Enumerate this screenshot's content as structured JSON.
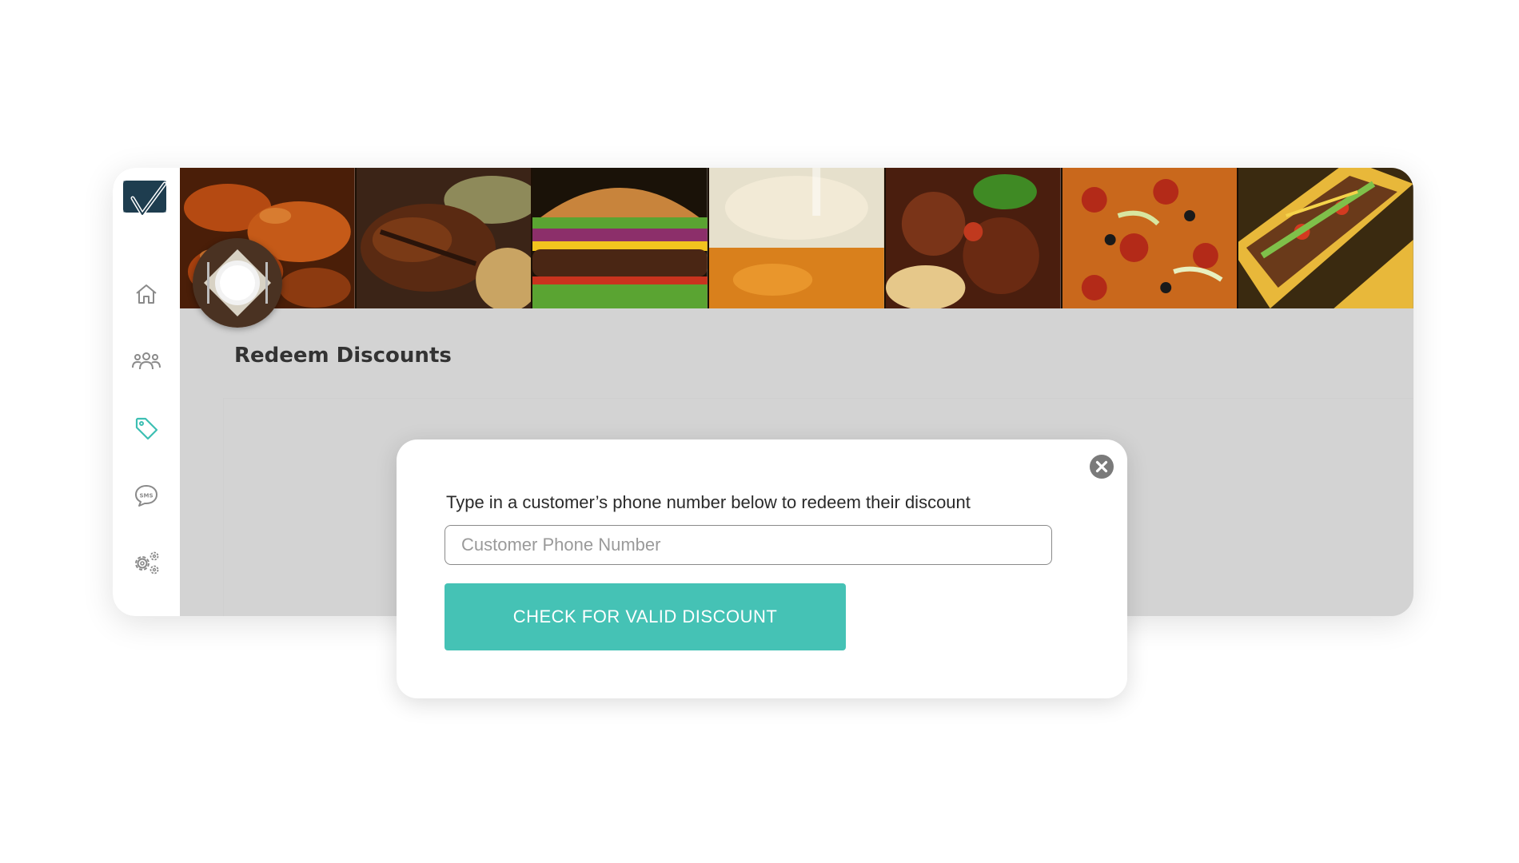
{
  "colors": {
    "accent": "#45c2b5",
    "active_nav": "#3dbfb3",
    "nav_icon": "#8a8a8a",
    "app_background": "#d3d3d3",
    "logo": "#1e3d4f"
  },
  "sidebar": {
    "logo_icon": "check-badge-icon",
    "items": [
      {
        "icon": "home-icon",
        "active": false
      },
      {
        "icon": "users-icon",
        "active": false
      },
      {
        "icon": "tag-icon",
        "active": true
      },
      {
        "icon": "sms-chat-icon",
        "active": false,
        "icon_text": "SMS"
      },
      {
        "icon": "settings-gears-icon",
        "active": false
      }
    ]
  },
  "banner": {
    "tiles": [
      "buffalo-wings",
      "bbq-ribs",
      "burger",
      "beer",
      "spaghetti-meatballs",
      "pizza",
      "tacos"
    ],
    "avatar_icon": "dinner-plate-icon"
  },
  "page": {
    "title": "Redeem Discounts"
  },
  "modal": {
    "instruction": "Type in a customer’s phone number below to redeem their discount",
    "phone_input": {
      "placeholder": "Customer Phone Number",
      "value": ""
    },
    "check_button_label": "CHECK FOR VALID DISCOUNT",
    "close_icon": "close-circle-icon"
  }
}
